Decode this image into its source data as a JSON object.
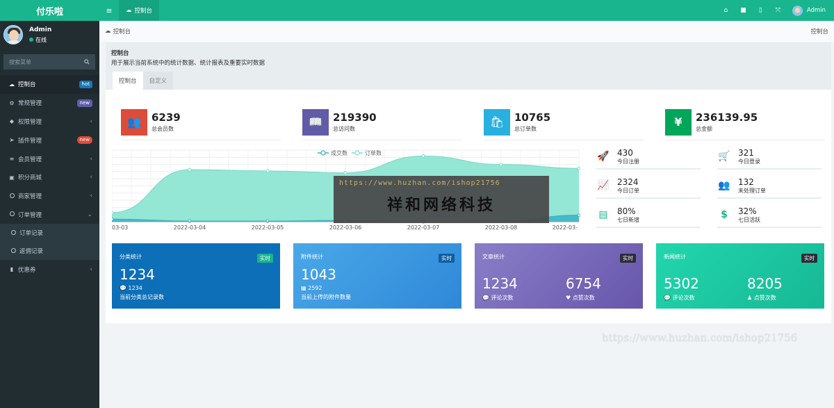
{
  "app": {
    "logo": "付乐啦"
  },
  "user": {
    "name": "Admin",
    "status": "在线"
  },
  "search": {
    "placeholder": "搜索菜单"
  },
  "menu": [
    {
      "label": "控制台",
      "icon": "☁",
      "badge": "hot"
    },
    {
      "label": "常规管理",
      "icon": "⚙",
      "badge": "new"
    },
    {
      "label": "权限管理",
      "icon": "◆",
      "chevron": "‹"
    },
    {
      "label": "插件管理",
      "icon": "➤",
      "badge": "new"
    },
    {
      "label": "会员管理",
      "icon": "≡",
      "chevron": "‹"
    },
    {
      "label": "积分商城",
      "icon": "▣",
      "chevron": "‹"
    },
    {
      "label": "商家管理",
      "chevron": "‹"
    },
    {
      "label": "订单管理",
      "chevron": "⌄"
    },
    {
      "label": "订单记录"
    },
    {
      "label": "返佣记录"
    },
    {
      "label": "优惠券",
      "icon": "▮",
      "chevron": "‹"
    }
  ],
  "topbar": {
    "toggle": "≡",
    "tab": "控制台",
    "user": "Admin",
    "icons": [
      "⌂",
      "■",
      "▯",
      "⤧"
    ]
  },
  "breadcrumb": {
    "left": "控制台",
    "right": "控制台"
  },
  "panel": {
    "title": "控制台",
    "desc": "用于展示当前系统中的统计数据、统计报表及重要实时数据",
    "tabs": [
      "控制台",
      "自定义"
    ]
  },
  "stats": [
    {
      "value": "6239",
      "label": "总会员数",
      "color": "#dd4b39",
      "icon": "👥"
    },
    {
      "value": "219390",
      "label": "总访问数",
      "color": "#605ca8",
      "icon": "📖"
    },
    {
      "value": "10765",
      "label": "总订单数",
      "color": "#28b0e0",
      "icon": "🛍"
    },
    {
      "value": "236139.95",
      "label": "总金额",
      "color": "#00a65a",
      "icon": "¥"
    }
  ],
  "chart_data": {
    "type": "area",
    "categories": [
      "2022-03-03",
      "2022-03-04",
      "2022-03-05",
      "2022-03-06",
      "2022-03-07",
      "2022-03-08",
      "2022-03-09"
    ],
    "tick_labels": [
      "03-03",
      "2022-03-04",
      "2022-03-05",
      "2022-03-06",
      "2022-03-07",
      "2022-03-08",
      "2022-03-"
    ],
    "series": [
      {
        "name": "成交数",
        "values": [
          4,
          1,
          1,
          2,
          0,
          1,
          10
        ],
        "color": "#3ab0c8"
      },
      {
        "name": "订单数",
        "values": [
          14,
          80,
          78,
          75,
          101,
          88,
          82
        ],
        "color": "#8ee6d2"
      }
    ],
    "ylim": [
      0,
      110
    ],
    "legend": "top-center",
    "grid": true
  },
  "mini_stats": [
    {
      "value": "430",
      "label": "今日注册",
      "icon": "🚀"
    },
    {
      "value": "321",
      "label": "今日登录",
      "icon": "🛒"
    },
    {
      "value": "2324",
      "label": "今日订单",
      "icon": "📈"
    },
    {
      "value": "132",
      "label": "未处理订单",
      "icon": "👥"
    },
    {
      "value": "80%",
      "label": "七日新增",
      "icon": "▤"
    },
    {
      "value": "32%",
      "label": "七日活跃",
      "icon": "$"
    }
  ],
  "cards": [
    {
      "title": "分类统计",
      "badge": "实时",
      "big": "1234",
      "small": "💬 1234",
      "caption": "当前分类总记录数",
      "bg": "#0c6fb8"
    },
    {
      "title": "附件统计",
      "badge": "实时",
      "big": "1043",
      "small": "▦ 2592",
      "caption": "当前上传的附件数量",
      "bg": "#3d9be0"
    },
    {
      "title": "文章统计",
      "badge": "实时",
      "left_big": "1234",
      "left_small": "💬 评论次数",
      "right_big": "6754",
      "right_small": "♥ 点赞次数",
      "bg": "#6f60b0"
    },
    {
      "title": "新闻统计",
      "badge": "实时",
      "left_big": "5302",
      "left_small": "💬 评论次数",
      "right_big": "8205",
      "right_small": "♟ 点赞次数",
      "bg": "#1ec9a0"
    }
  ],
  "watermark": {
    "url": "https://www.huzhan.com/ishop21756",
    "name": "祥和网络科技",
    "footer": "https://www.huzhan.com/ishop21756"
  }
}
